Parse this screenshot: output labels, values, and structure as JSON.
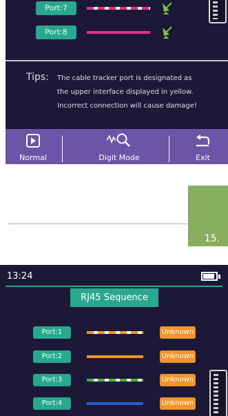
{
  "top_screen": {
    "ports": [
      {
        "label": "Port:7",
        "wire": "dashed-pink"
      },
      {
        "label": "Port:8",
        "wire": "solid-pink"
      }
    ],
    "tips_label": "Tips:",
    "tips_lines": [
      "The cable tracker port is designated as",
      "the upper interface displayed in yellow.",
      "Incorrect connection will cause damage!"
    ],
    "bottom_bar": {
      "normal": "Normal",
      "digit_mode": "Digit Mode",
      "exit": "Exit"
    }
  },
  "page_number": "15.",
  "bottom_screen": {
    "time": "13:24",
    "title": "RJ45 Sequence",
    "rows": [
      {
        "port": "Port:1",
        "status": "Unknown",
        "wire_color": "#f0952a",
        "wire_style": "dashed"
      },
      {
        "port": "Port:2",
        "status": "Unknown",
        "wire_color": "#f0952a",
        "wire_style": "solid"
      },
      {
        "port": "Port:3",
        "status": "Unknown",
        "wire_color": "#4caf3a",
        "wire_style": "dashed"
      },
      {
        "port": "Port:4",
        "status": "Unknown",
        "wire_color": "#2a5fd0",
        "wire_style": "solid"
      }
    ]
  },
  "colors": {
    "screen_bg": "#1c1838",
    "teal": "#2aa88f",
    "pink_wire": "#e0338a",
    "bar_purple": "#6a55a6",
    "status_orange": "#f0952a",
    "page_tab_green": "#87ad5d"
  }
}
